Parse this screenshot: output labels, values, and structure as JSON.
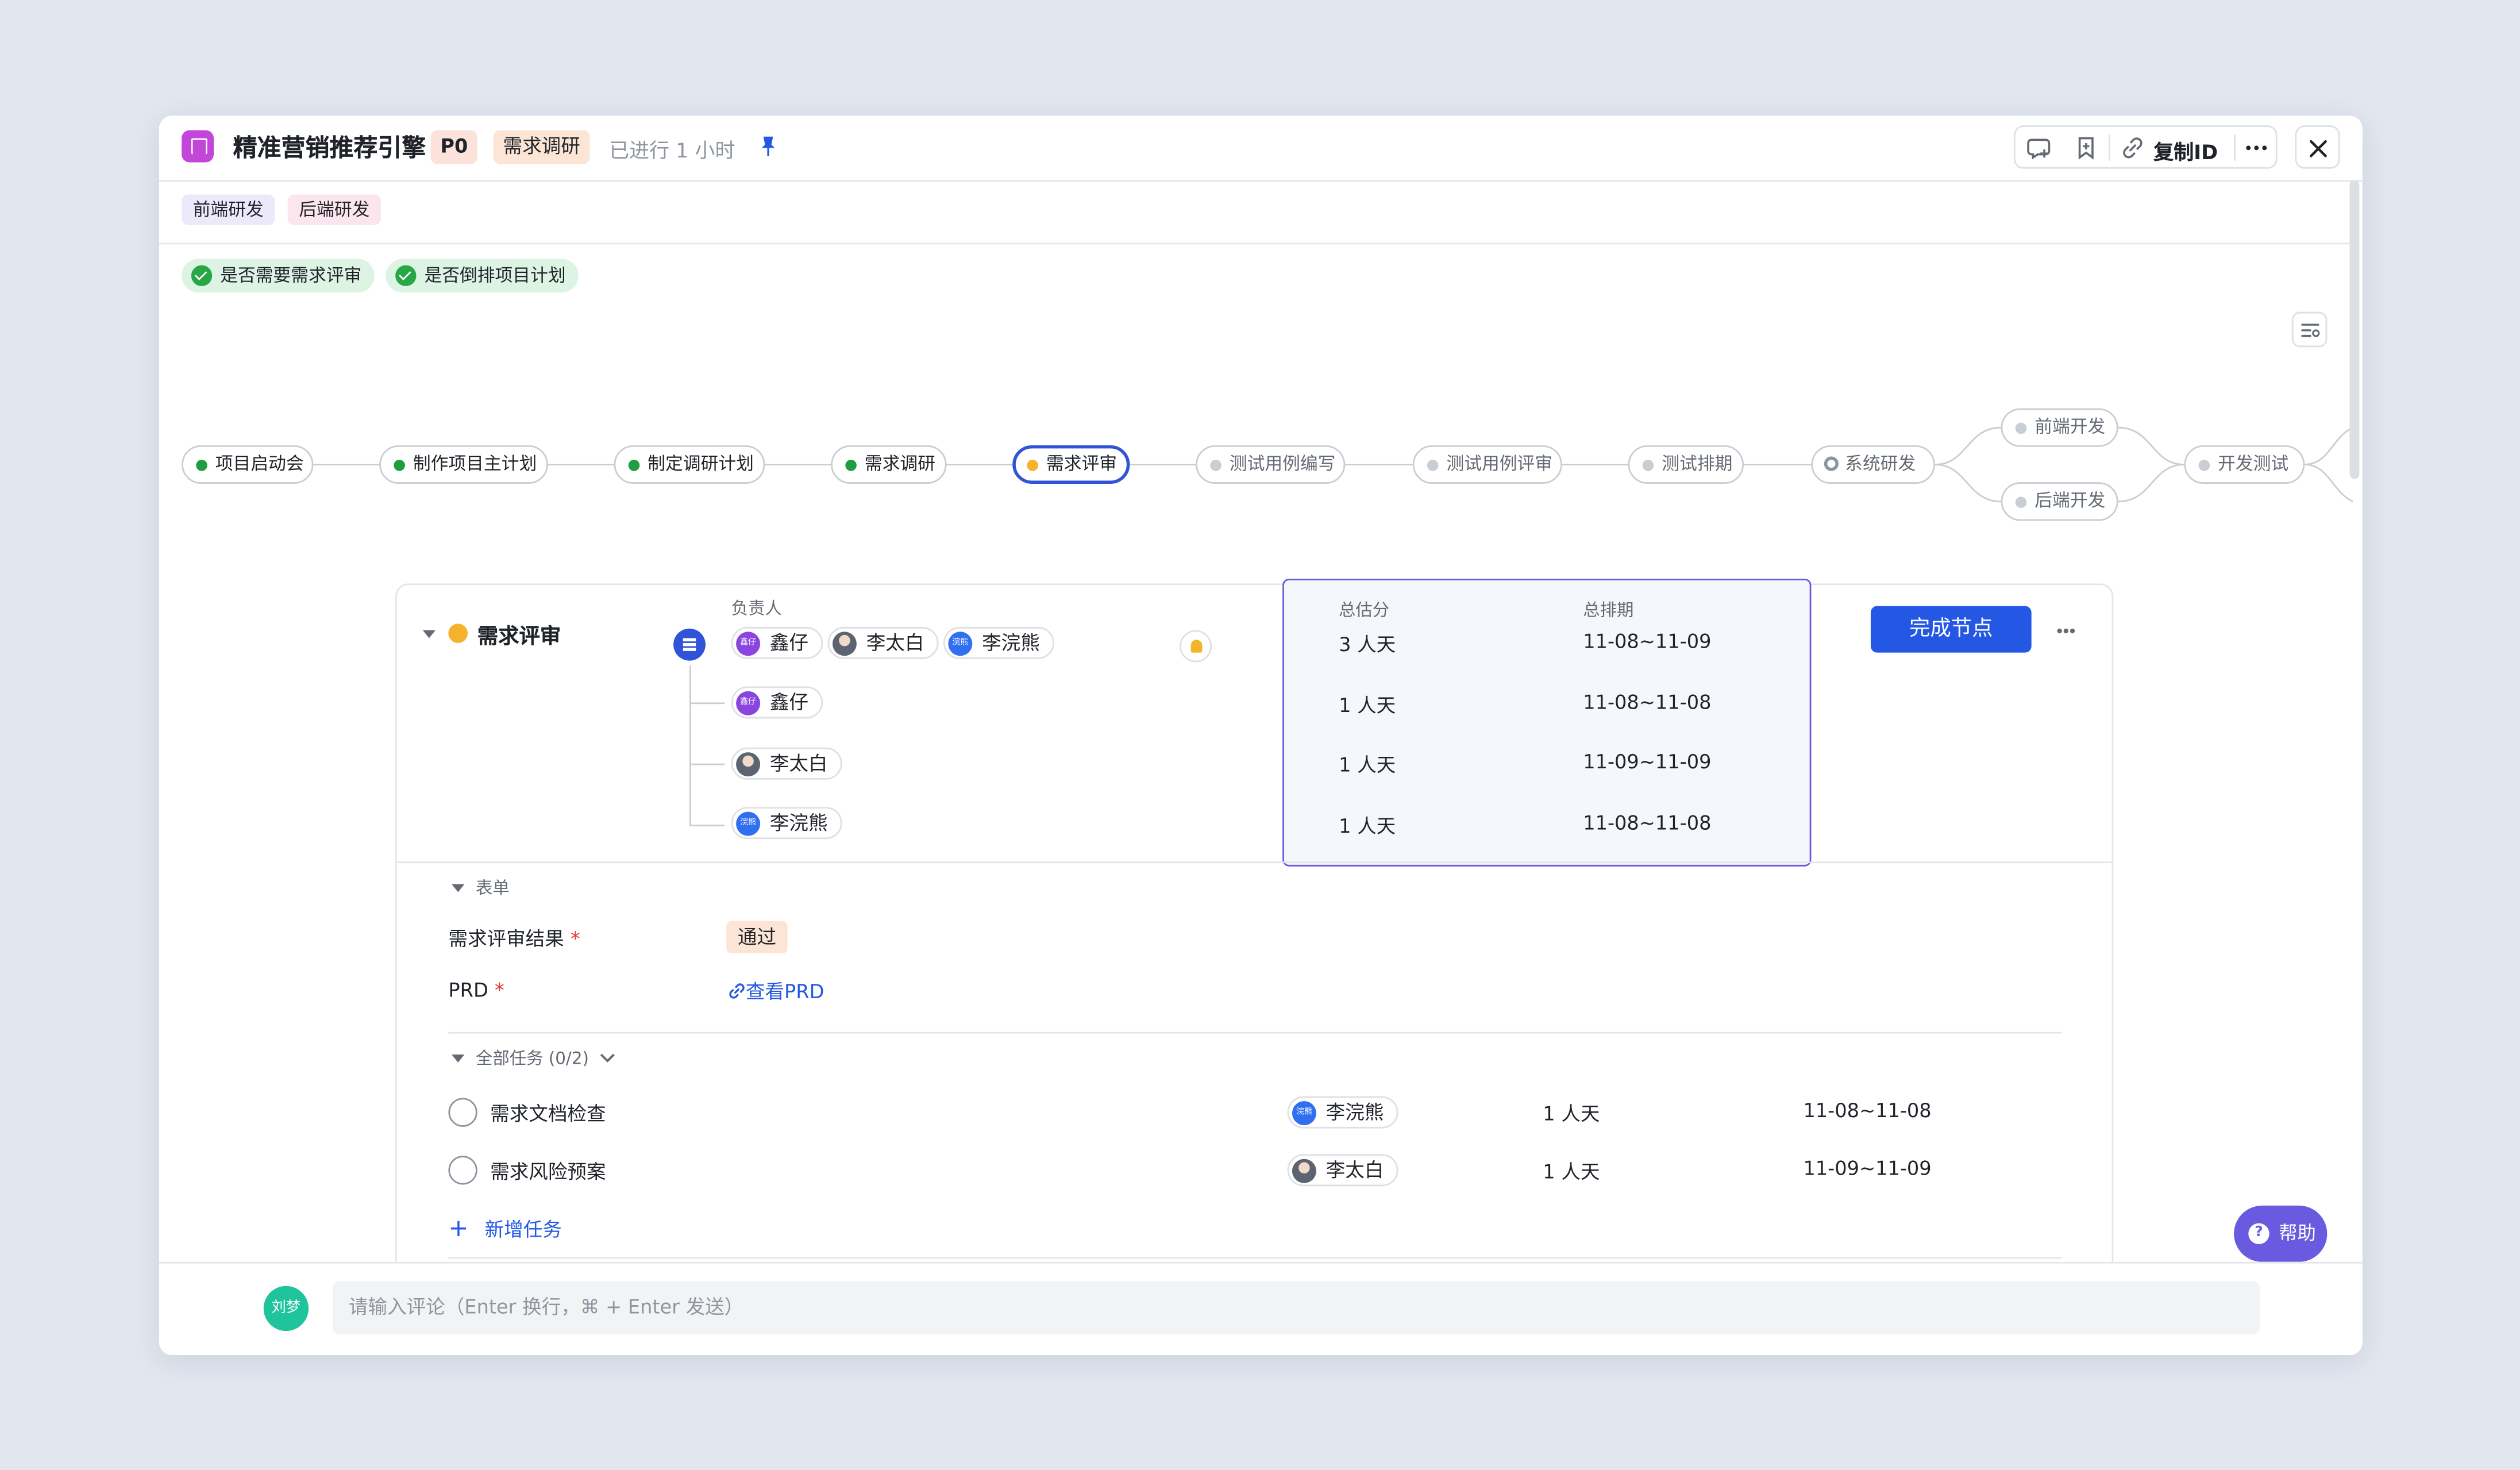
{
  "header": {
    "title": "精准营销推荐引擎",
    "priority": "P0",
    "stage": "需求调研",
    "elapsed": "已进行 1 小时",
    "copy_id_label": "复制ID"
  },
  "tags": [
    "前端研发",
    "后端研发"
  ],
  "checks": [
    "是否需要需求评审",
    "是否倒排项目计划"
  ],
  "flow": {
    "nodes": [
      {
        "label": "项目启动会",
        "state": "done"
      },
      {
        "label": "制作项目主计划",
        "state": "done"
      },
      {
        "label": "制定调研计划",
        "state": "done"
      },
      {
        "label": "需求调研",
        "state": "done"
      },
      {
        "label": "需求评审",
        "state": "current"
      },
      {
        "label": "测试用例编写",
        "state": "pending"
      },
      {
        "label": "测试用例评审",
        "state": "pending"
      },
      {
        "label": "测试排期",
        "state": "pending"
      },
      {
        "label": "系统研发",
        "state": "partial"
      },
      {
        "label": "前端开发",
        "state": "pending"
      },
      {
        "label": "后端开发",
        "state": "pending"
      },
      {
        "label": "开发测试",
        "state": "pending"
      }
    ]
  },
  "stage_card": {
    "name": "需求评审",
    "owner_label": "负责人",
    "owners": [
      "鑫仔",
      "李太白",
      "李浣熊"
    ],
    "est_header": "总估分",
    "sched_header": "总排期",
    "summary": {
      "estimate": "3 人天",
      "schedule": "11-08~11-09"
    },
    "assignments": [
      {
        "person": "鑫仔",
        "estimate": "1 人天",
        "schedule": "11-08~11-08"
      },
      {
        "person": "李太白",
        "estimate": "1 人天",
        "schedule": "11-09~11-09"
      },
      {
        "person": "李浣熊",
        "estimate": "1 人天",
        "schedule": "11-08~11-08"
      }
    ],
    "complete_label": "完成节点",
    "avatar_text": {
      "xinzai": "鑫仔",
      "lihuanxiong": "浣熊"
    }
  },
  "form": {
    "section_label": "表单",
    "result_label": "需求评审结果",
    "result_value": "通过",
    "prd_label": "PRD",
    "prd_link": "查看PRD",
    "required_mark": "*"
  },
  "tasks": {
    "section_label": "全部任务 (0/2)",
    "items": [
      {
        "name": "需求文档检查",
        "person": "李浣熊",
        "estimate": "1 人天",
        "schedule": "11-08~11-08"
      },
      {
        "name": "需求风险预案",
        "person": "李太白",
        "estimate": "1 人天",
        "schedule": "11-09~11-09"
      }
    ],
    "add_label": "新增任务"
  },
  "help_label": "帮助",
  "comment": {
    "user": "刘梦",
    "placeholder": "请输入评论（Enter 换行，⌘ + Enter 发送）"
  },
  "colors": {
    "primary": "#2458e4",
    "done": "#1e9e41",
    "current": "#f5b22b",
    "help": "#6a5ae0"
  }
}
